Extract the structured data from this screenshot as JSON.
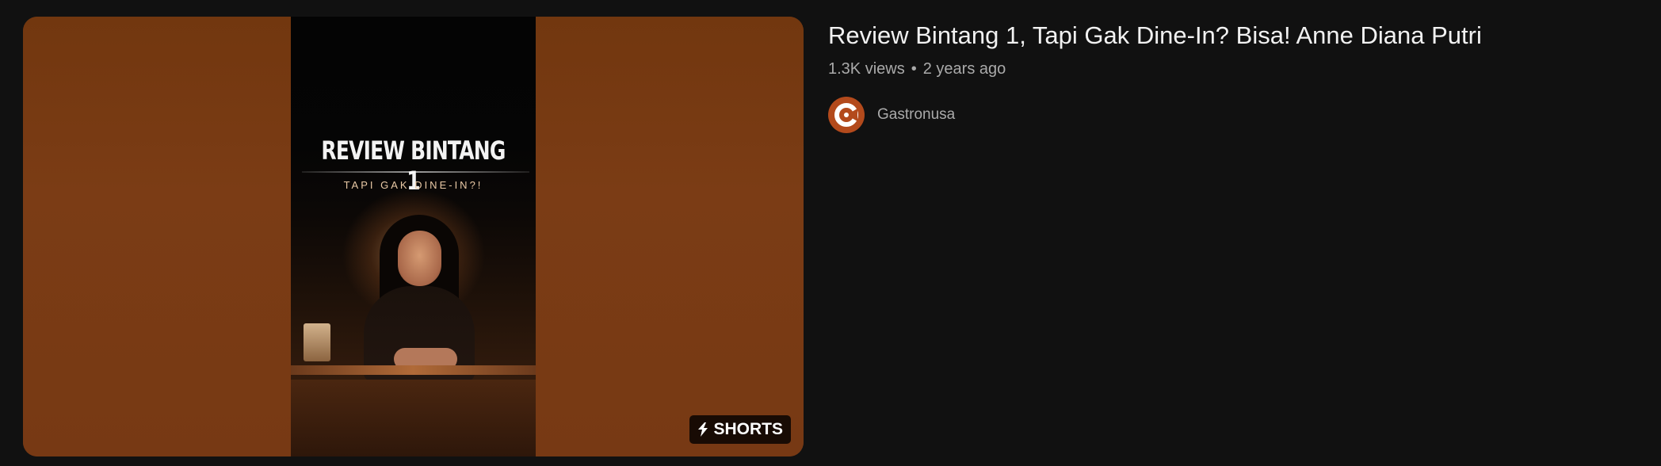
{
  "video": {
    "title": "Review Bintang 1, Tapi Gak Dine-In? Bisa! Anne Diana Putri",
    "views": "1.3K views",
    "separator": "•",
    "age": "2 years ago",
    "channel": {
      "name": "Gastronusa",
      "avatar_color": "#b34a1c"
    },
    "thumbnail": {
      "overlay_title": "REVIEW BINTANG 1",
      "overlay_subtitle": "TAPI GAK DINE-IN?!",
      "badge_label": "SHORTS",
      "background_color": "#7a3b15"
    }
  }
}
